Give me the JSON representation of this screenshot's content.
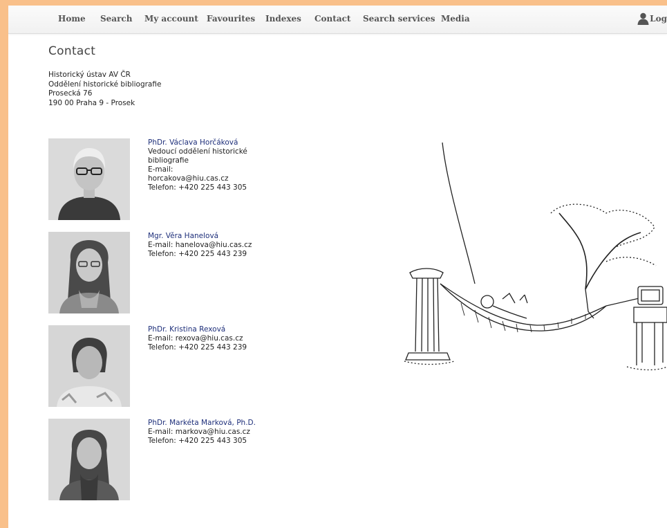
{
  "nav": {
    "items": [
      "Home",
      "Search",
      "My account",
      "Favourites",
      "Indexes",
      "Contact",
      "Search services",
      "Media"
    ],
    "login_label": "Log"
  },
  "page": {
    "title": "Contact"
  },
  "address": {
    "lines": [
      "Historický ústav AV ČR",
      "Oddělení historické bibliografie",
      "Prosecká 76",
      "190 00 Praha 9 - Prosek"
    ]
  },
  "people": [
    {
      "name": "PhDr. Václava Horčáková",
      "lines": [
        "Vedoucí oddělení historické bibliografie",
        "E-mail:",
        "horcakova@hiu.cas.cz",
        "Telefon: +420 225 443 305"
      ]
    },
    {
      "name": "Mgr. Věra Hanelová",
      "lines": [
        "E-mail: hanelova@hiu.cas.cz",
        "Telefon: +420 225 443 239"
      ]
    },
    {
      "name": "PhDr. Kristina Rexová",
      "lines": [
        "E-mail: rexova@hiu.cas.cz",
        "Telefon: +420 225 443 239"
      ]
    },
    {
      "name": "PhDr. Markéta Marková, Ph.D.",
      "lines": [
        "E-mail: markova@hiu.cas.cz",
        "Telefon: +420 225 443 305"
      ]
    }
  ],
  "colors": {
    "background": "#f9c08a",
    "link": "#1e2f7a",
    "nav_text": "#555555"
  }
}
